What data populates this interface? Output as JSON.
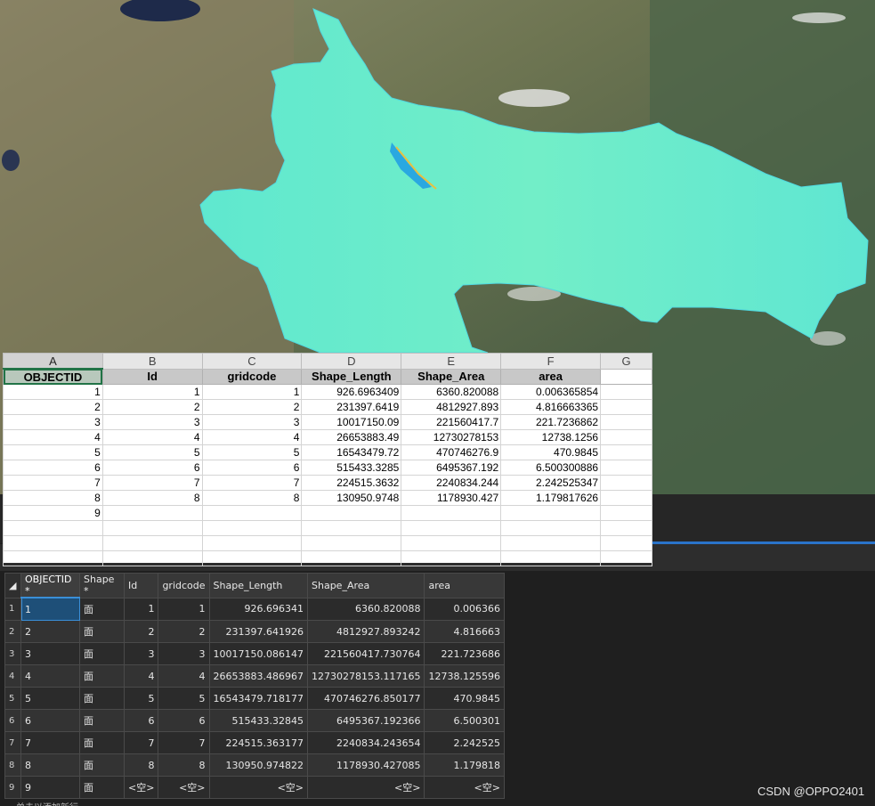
{
  "excel": {
    "column_letters": [
      "A",
      "B",
      "C",
      "D",
      "E",
      "F",
      "G"
    ],
    "headers": [
      "OBJECTID",
      "Id",
      "gridcode",
      "Shape_Length",
      "Shape_Area",
      "area"
    ],
    "rows": [
      [
        "1",
        "1",
        "1",
        "926.6963409",
        "6360.820088",
        "0.006365854"
      ],
      [
        "2",
        "2",
        "2",
        "231397.6419",
        "4812927.893",
        "4.816663365"
      ],
      [
        "3",
        "3",
        "3",
        "10017150.09",
        "221560417.7",
        "221.7236862"
      ],
      [
        "4",
        "4",
        "4",
        "26653883.49",
        "12730278153",
        "12738.1256"
      ],
      [
        "5",
        "5",
        "5",
        "16543479.72",
        "470746276.9",
        "470.9845"
      ],
      [
        "6",
        "6",
        "6",
        "515433.3285",
        "6495367.192",
        "6.500300886"
      ],
      [
        "7",
        "7",
        "7",
        "224515.3632",
        "2240834.244",
        "2.242525347"
      ],
      [
        "8",
        "8",
        "8",
        "130950.9748",
        "1178930.427",
        "1.179817626"
      ],
      [
        "9",
        "",
        "",
        "",
        "",
        ""
      ]
    ]
  },
  "attribute_table": {
    "headers": [
      "OBJECTID *",
      "Shape *",
      "Id",
      "gridcode",
      "Shape_Length",
      "Shape_Area",
      "area"
    ],
    "rows": [
      {
        "n": "1",
        "cells": [
          "1",
          "面",
          "1",
          "1",
          "926.696341",
          "6360.820088",
          "0.006366"
        ]
      },
      {
        "n": "2",
        "cells": [
          "2",
          "面",
          "2",
          "2",
          "231397.641926",
          "4812927.893242",
          "4.816663"
        ]
      },
      {
        "n": "3",
        "cells": [
          "3",
          "面",
          "3",
          "3",
          "10017150.086147",
          "221560417.730764",
          "221.723686"
        ]
      },
      {
        "n": "4",
        "cells": [
          "4",
          "面",
          "4",
          "4",
          "26653883.486967",
          "12730278153.117165",
          "12738.125596"
        ]
      },
      {
        "n": "5",
        "cells": [
          "5",
          "面",
          "5",
          "5",
          "16543479.718177",
          "470746276.850177",
          "470.9845"
        ]
      },
      {
        "n": "6",
        "cells": [
          "6",
          "面",
          "6",
          "6",
          "515433.32845",
          "6495367.192366",
          "6.500301"
        ]
      },
      {
        "n": "7",
        "cells": [
          "7",
          "面",
          "7",
          "7",
          "224515.363177",
          "2240834.243654",
          "2.242525"
        ]
      },
      {
        "n": "8",
        "cells": [
          "8",
          "面",
          "8",
          "8",
          "130950.974822",
          "1178930.427085",
          "1.179818"
        ]
      },
      {
        "n": "9",
        "cells": [
          "9",
          "面",
          "<空>",
          "<空>",
          "<空>",
          "<空>",
          "<空>"
        ]
      }
    ],
    "footer_text": "单击以添加新行。"
  },
  "watermark": "CSDN @OPPO2401"
}
